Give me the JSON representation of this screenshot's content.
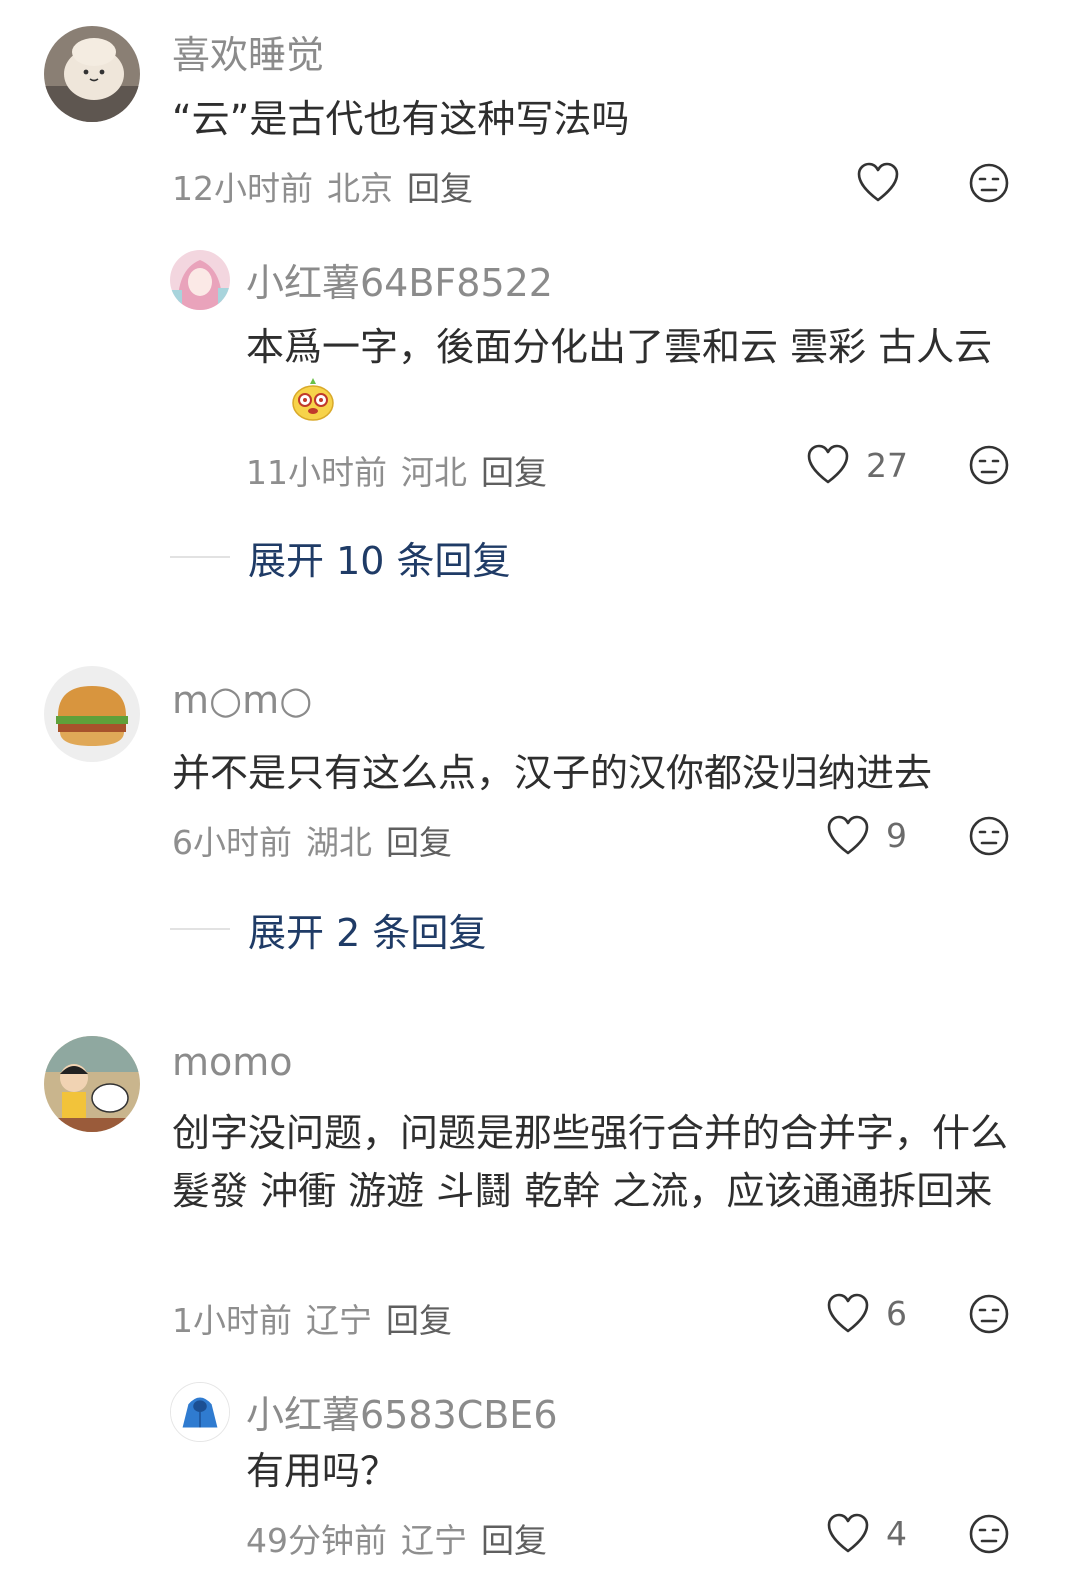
{
  "comments": [
    {
      "username": "喜欢睡觉",
      "text": "“云”是古代也有这种写法吗",
      "time": "12小时前",
      "location": "北京",
      "reply_label": "回复",
      "like_count": "",
      "replies": [
        {
          "username": "小红薯64BF8522",
          "text": "本爲一字，後面分化出了雲和云 雲彩 古人云",
          "time": "11小时前",
          "location": "河北",
          "reply_label": "回复",
          "like_count": "27"
        }
      ],
      "expand_label": "展开 10 条回复"
    },
    {
      "username": "m○m○",
      "text": "并不是只有这么点，汉子的汉你都没归纳进去",
      "time": "6小时前",
      "location": "湖北",
      "reply_label": "回复",
      "like_count": "9",
      "expand_label": "展开 2 条回复"
    },
    {
      "username": "momo",
      "text": "创字没问题，问题是那些强行合并的合并字，什么 髮發 沖衝 游遊 斗鬪 乾幹 之流，应该通通拆回来",
      "time": "1小时前",
      "location": "辽宁",
      "reply_label": "回复",
      "like_count": "6",
      "replies": [
        {
          "username": "小红薯6583CBE6",
          "text": "有用吗？",
          "time": "49分钟前",
          "location": "辽宁",
          "reply_label": "回复",
          "like_count": "4"
        }
      ]
    }
  ],
  "colors": {
    "background": "#ffffff",
    "username": "#8b8b8b",
    "expand": "#1f3b66",
    "meta": "#8e8e8e"
  },
  "icons": [
    "heart-outline-icon",
    "dislike-face-icon",
    "emoji-sticker-icon"
  ]
}
